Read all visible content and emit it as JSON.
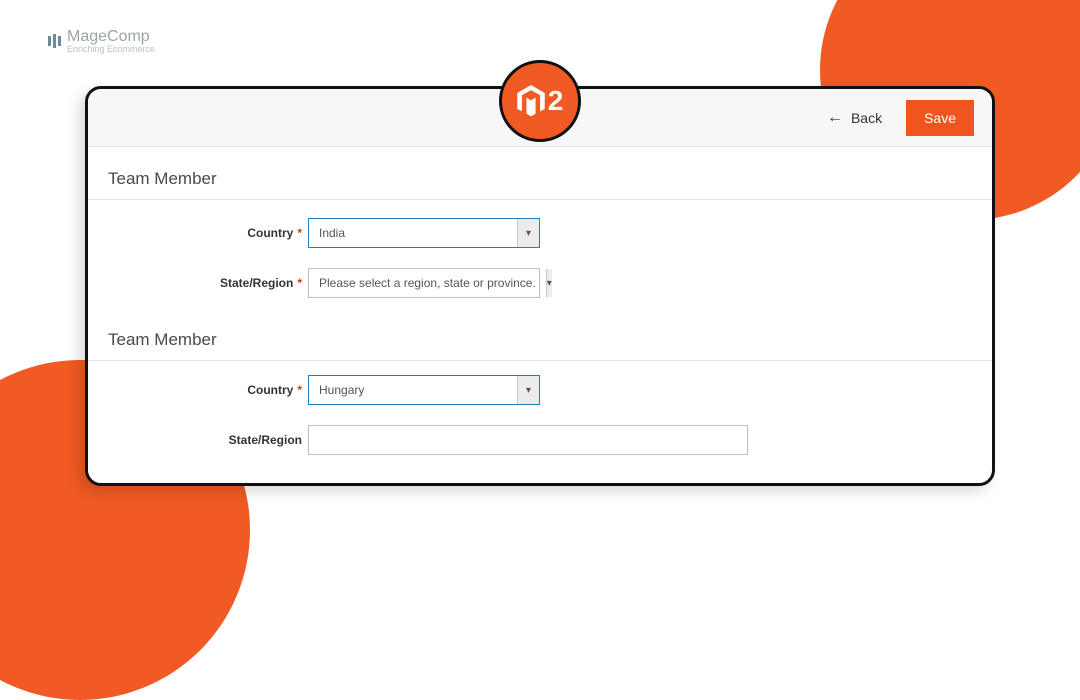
{
  "brand": {
    "name": "MageComp",
    "tagline": "Enriching Ecommerce"
  },
  "badge": {
    "label": "2"
  },
  "toolbar": {
    "back_label": "Back",
    "save_label": "Save"
  },
  "sections": [
    {
      "title": "Team Member",
      "country": {
        "label": "Country",
        "value": "India"
      },
      "state": {
        "label": "State/Region",
        "value": "Please select a region, state or province."
      }
    },
    {
      "title": "Team Member",
      "country": {
        "label": "Country",
        "value": "Hungary"
      },
      "state": {
        "label": "State/Region",
        "value": ""
      }
    }
  ]
}
